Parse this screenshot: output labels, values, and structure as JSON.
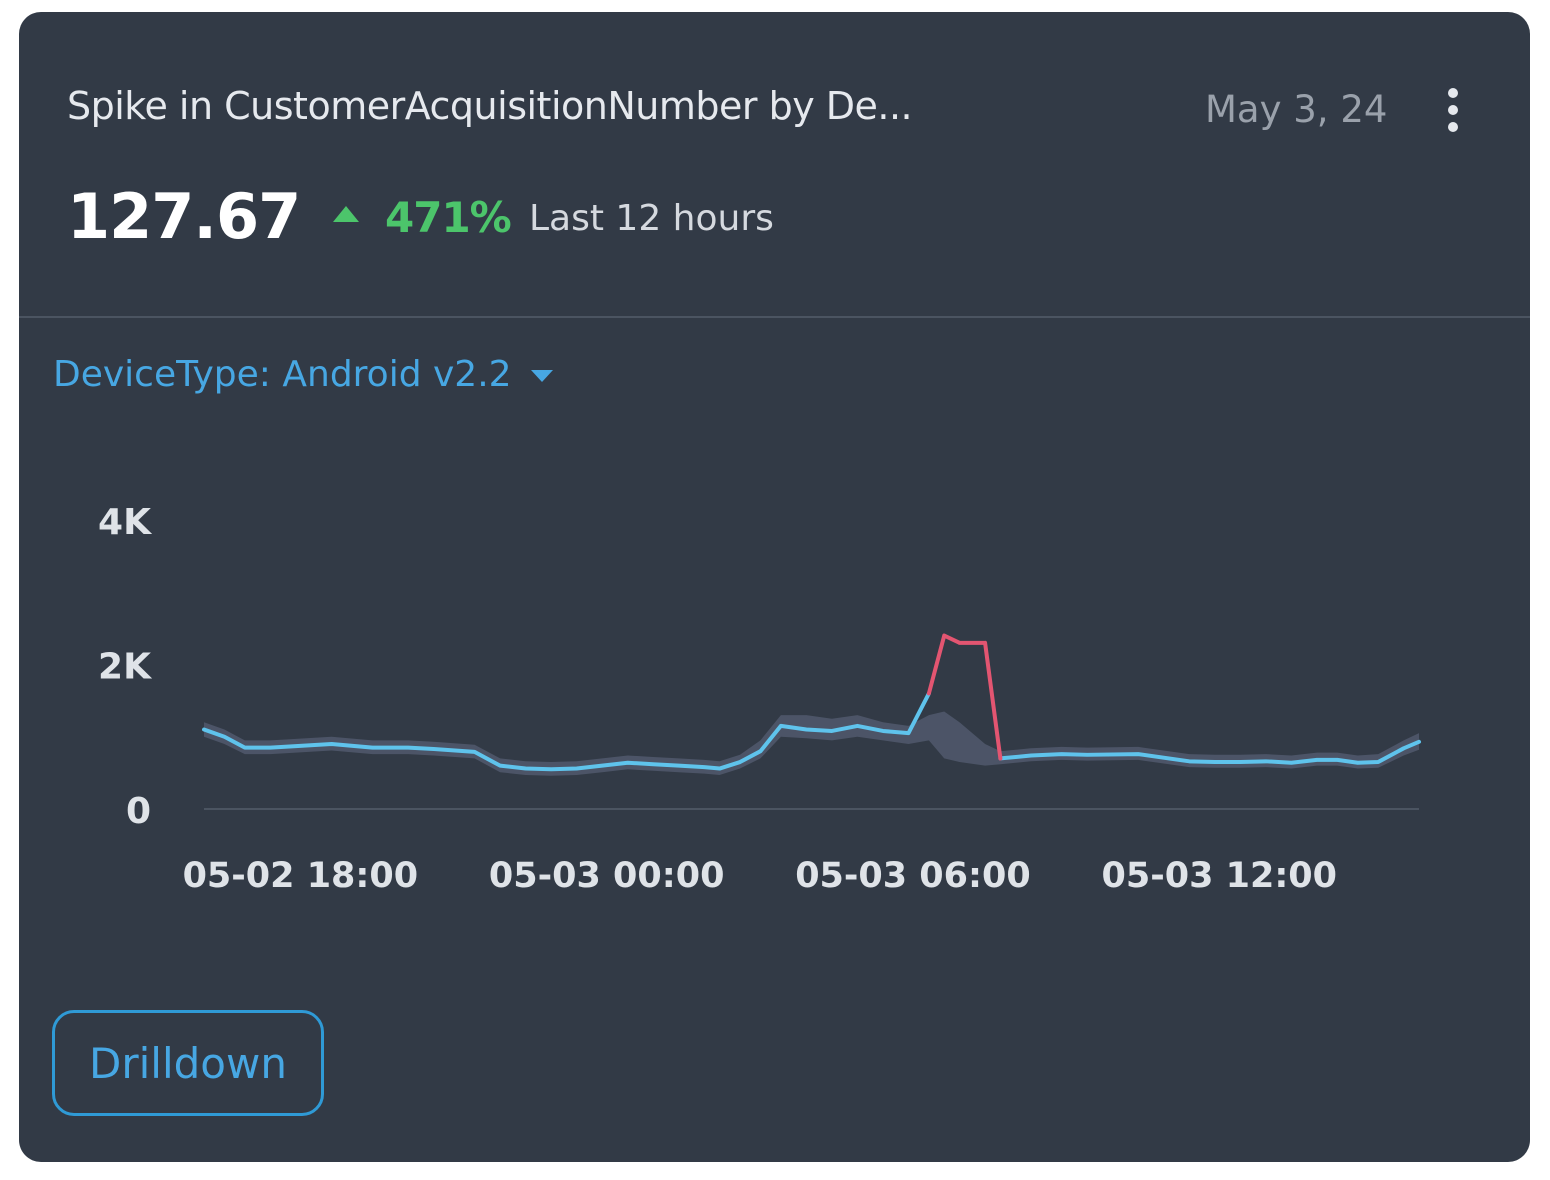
{
  "card": {
    "title": "Spike in CustomerAcquisitionNumber by De...",
    "date": "May 3, 24",
    "kpi": {
      "value": "127.67",
      "change": "471%",
      "direction": "up",
      "period": "Last 12 hours"
    },
    "filter": {
      "label": "DeviceType: Android v2.2"
    },
    "drilldown_label": "Drilldown"
  },
  "icons": {
    "menu": "kebab-vertical-icon",
    "trend": "triangle-up-icon",
    "filter_caret": "caret-down-icon"
  },
  "colors": {
    "card_bg": "#323a46",
    "title": "#e6e9ee",
    "accent_blue": "#47a7e3",
    "increase_green": "#4cc56b",
    "line": "#5fc3ec",
    "anomaly": "#e35571",
    "band": "#4f586a"
  },
  "chart_data": {
    "type": "line",
    "x_ticks": [
      "05-02 18:00",
      "05-03 00:00",
      "05-03 06:00",
      "05-03 12:00"
    ],
    "y_ticks": [
      "0",
      "2K",
      "4K"
    ],
    "ylim": [
      0,
      4000
    ],
    "xlim": [
      16.7,
      40.5
    ],
    "grid": false,
    "series": [
      {
        "x": [
          16.7,
          17.1,
          17.5,
          18.0,
          18.5,
          19.2,
          20.0,
          20.7,
          21.2,
          22.0,
          22.5,
          23.0,
          23.5,
          24.0,
          24.5,
          25.0,
          25.5,
          26.0,
          26.5,
          26.8,
          27.2,
          27.6,
          28.0,
          28.5,
          29.0,
          29.5,
          30.0,
          30.5,
          30.9,
          31.2,
          31.5,
          32.0,
          32.3,
          32.9,
          33.5,
          34.0,
          35.0,
          36.0,
          36.5,
          37.0,
          37.5,
          38.0,
          38.5,
          38.9,
          39.3,
          39.7,
          40.2,
          40.5
        ],
        "y": [
          1100,
          1000,
          850,
          850,
          870,
          900,
          850,
          850,
          830,
          790,
          600,
          560,
          550,
          560,
          600,
          640,
          620,
          600,
          580,
          560,
          650,
          800,
          1150,
          1100,
          1080,
          1150,
          1080,
          1050,
          1600,
          2400,
          2300,
          2300,
          700,
          740,
          760,
          750,
          760,
          660,
          650,
          650,
          660,
          640,
          680,
          680,
          640,
          650,
          840,
          930
        ]
      }
    ],
    "anomaly_range": [
      30.9,
      32.3
    ],
    "band": {
      "upper": [
        1200,
        1100,
        950,
        950,
        970,
        1000,
        950,
        950,
        930,
        890,
        700,
        660,
        650,
        660,
        700,
        740,
        720,
        700,
        680,
        660,
        750,
        950,
        1300,
        1300,
        1250,
        1300,
        1200,
        1150,
        1300,
        1350,
        1200,
        900,
        800,
        840,
        860,
        850,
        860,
        760,
        750,
        750,
        760,
        740,
        780,
        780,
        740,
        760,
        950,
        1050
      ],
      "lower": [
        1000,
        900,
        760,
        760,
        780,
        810,
        760,
        760,
        740,
        700,
        510,
        470,
        460,
        470,
        510,
        550,
        530,
        510,
        490,
        470,
        560,
        700,
        1000,
        980,
        950,
        1000,
        950,
        900,
        950,
        700,
        650,
        600,
        620,
        660,
        680,
        670,
        680,
        580,
        570,
        570,
        580,
        560,
        600,
        600,
        560,
        570,
        740,
        820
      ]
    }
  }
}
